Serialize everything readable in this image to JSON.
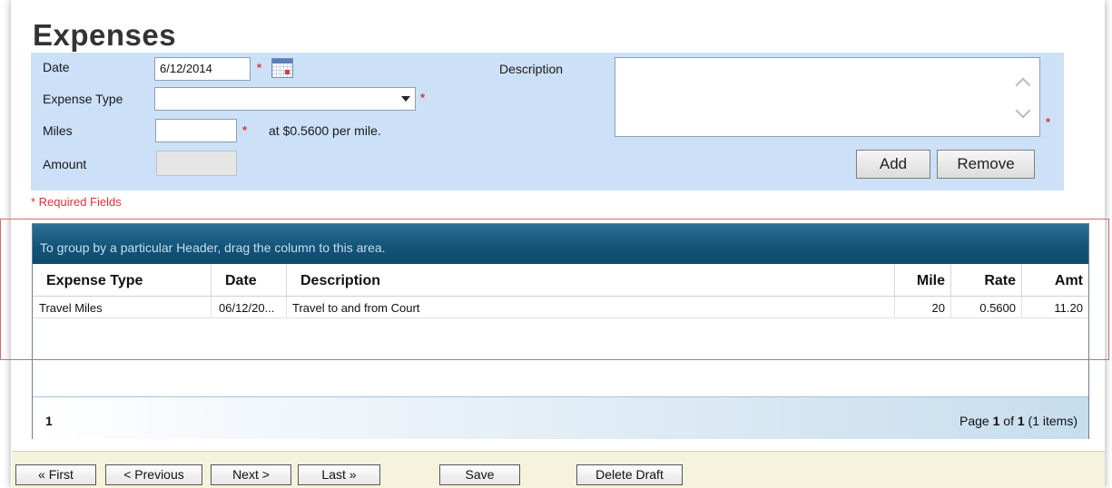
{
  "page": {
    "title": "Expenses"
  },
  "form": {
    "date_label": "Date",
    "date_value": "6/12/2014",
    "expense_type_label": "Expense Type",
    "expense_type_value": "",
    "miles_label": "Miles",
    "miles_value": "",
    "rate_text": "at $0.5600 per mile.",
    "amount_label": "Amount",
    "amount_value": "",
    "description_label": "Description",
    "description_value": "",
    "required_star": "*",
    "add_label": "Add",
    "remove_label": "Remove",
    "required_note": "* Required Fields"
  },
  "grid": {
    "group_hint": "To group by a particular Header, drag the column to this area.",
    "columns": [
      "Expense Type",
      "Date",
      "Description",
      "Mile",
      "Rate",
      "Amt"
    ],
    "rows": [
      {
        "expense_type": "Travel Miles",
        "date": "06/12/20...",
        "description": "Travel to and from Court",
        "mile": "20",
        "rate": "0.5600",
        "amt": "11.20"
      }
    ],
    "footer_page_number": "1",
    "pager": {
      "page_word": "Page",
      "current": "1",
      "of_word": "of",
      "total": "1",
      "items_text": "(1 items)"
    }
  },
  "nav": {
    "first": "« First",
    "previous": "< Previous",
    "next": "Next >",
    "last": "Last »",
    "save": "Save",
    "delete_draft": "Delete Draft"
  },
  "colors": {
    "form_panel": "#cce0f7",
    "header_bar": "#135277",
    "required": "#e0333a",
    "bottom_bar": "#f6f3dc"
  },
  "icons": [
    "calendar-icon",
    "chevron-down-icon",
    "scroll-up-icon",
    "scroll-down-icon"
  ]
}
